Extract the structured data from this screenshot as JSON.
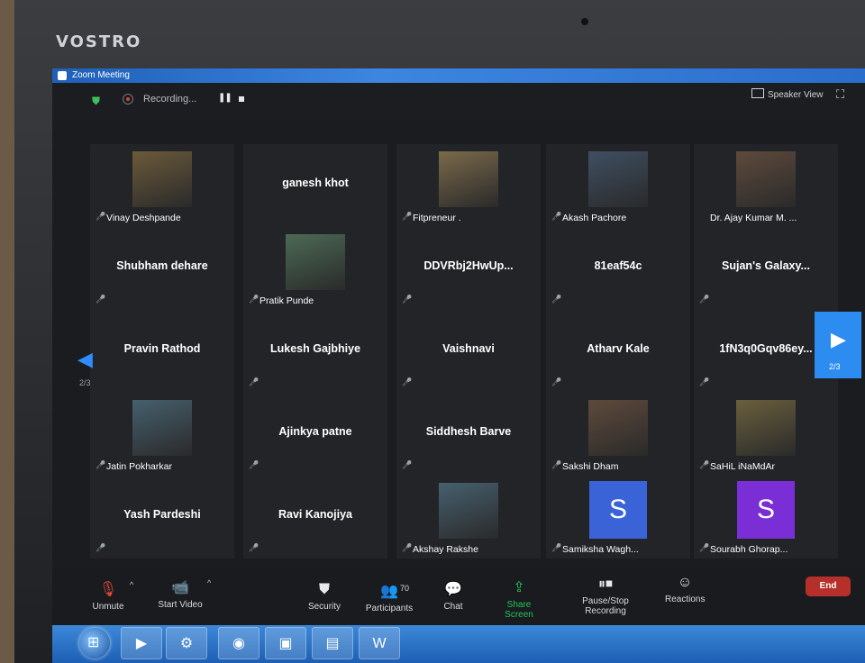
{
  "device": {
    "brand": "VOSTRO"
  },
  "window": {
    "title": "Zoom Meeting"
  },
  "meeting_bar": {
    "recording_text": "Recording...",
    "view_label": "Speaker View"
  },
  "navigation": {
    "page_left": "2/3",
    "page_right": "2/3"
  },
  "participants": [
    {
      "name": "Vinay Deshpande",
      "has_photo": true,
      "muted": true
    },
    {
      "name": "ganesh khot",
      "has_photo": false,
      "muted": false
    },
    {
      "name": "Fitpreneur .",
      "has_photo": true,
      "muted": true
    },
    {
      "name": "Akash Pachore",
      "has_photo": true,
      "muted": true
    },
    {
      "name": "Dr. Ajay Kumar M. ...",
      "has_photo": true,
      "muted": false
    },
    {
      "name": "Shubham dehare",
      "has_photo": false,
      "muted": true
    },
    {
      "name": "Pratik Punde",
      "has_photo": true,
      "muted": true
    },
    {
      "name": "DDVRbj2HwUp...",
      "has_photo": false,
      "muted": true
    },
    {
      "name": "81eaf54c",
      "has_photo": false,
      "muted": true
    },
    {
      "name": "Sujan's  Galaxy...",
      "has_photo": false,
      "muted": true
    },
    {
      "name": "Pravin Rathod",
      "has_photo": false,
      "muted": false
    },
    {
      "name": "Lukesh Gajbhiye",
      "has_photo": false,
      "muted": true
    },
    {
      "name": "Vaishnavi",
      "has_photo": false,
      "muted": true
    },
    {
      "name": "Atharv Kale",
      "has_photo": false,
      "muted": true
    },
    {
      "name": "1fN3q0Gqv86ey...",
      "has_photo": false,
      "muted": true
    },
    {
      "name": "Jatin Pokharkar",
      "has_photo": true,
      "muted": true
    },
    {
      "name": "Ajinkya patne",
      "has_photo": false,
      "muted": true
    },
    {
      "name": "Siddhesh Barve",
      "has_photo": false,
      "muted": true
    },
    {
      "name": "Sakshi Dham",
      "has_photo": true,
      "muted": true
    },
    {
      "name": "SaHiL iNaMdAr",
      "has_photo": true,
      "muted": true
    },
    {
      "name": "Yash Pardeshi",
      "has_photo": false,
      "muted": true
    },
    {
      "name": "Ravi Kanojiya",
      "has_photo": false,
      "muted": true
    },
    {
      "name": "Akshay Rakshe",
      "has_photo": true,
      "muted": true
    },
    {
      "name": "Samiksha Wagh...",
      "avatar_letter": "S",
      "avatar_color": "#3b63d8",
      "muted": true
    },
    {
      "name": "Sourabh Ghorap...",
      "avatar_letter": "S",
      "avatar_color": "#7a2fd6",
      "muted": true
    }
  ],
  "toolbar": {
    "unmute": "Unmute",
    "start_video": "Start Video",
    "security": "Security",
    "participants": "Participants",
    "participants_count": "70",
    "chat": "Chat",
    "share_screen": "Share Screen",
    "pause_stop": "Pause/Stop Recording",
    "reactions": "Reactions",
    "end": "End"
  },
  "colors": {
    "accent": "#2d8cf0",
    "muted_red": "#e14a3b",
    "share_green": "#21c65a",
    "end_red": "#b5302a"
  }
}
